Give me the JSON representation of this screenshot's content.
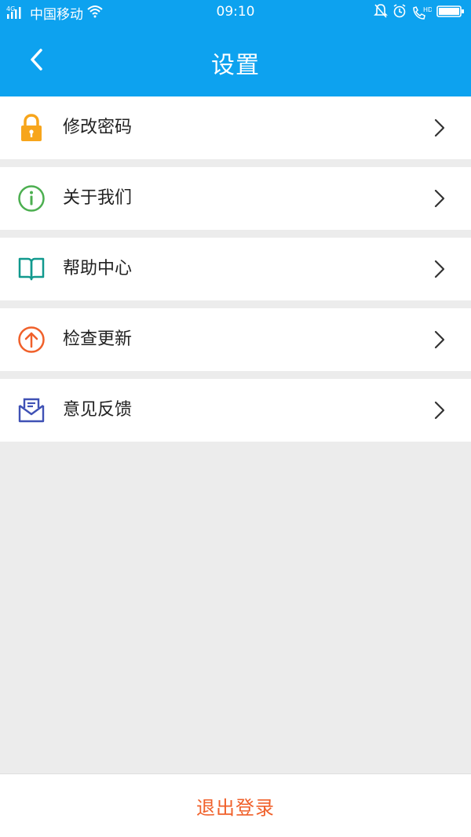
{
  "statusbar": {
    "network_badge": "4G",
    "carrier": "中国移动",
    "time": "09:10",
    "hd_badge": "HD",
    "icons": [
      "signal-icon",
      "wifi-icon",
      "mute-icon",
      "alarm-icon",
      "hd-call-icon",
      "battery-icon"
    ]
  },
  "navbar": {
    "title": "设置",
    "back_icon": "chevron-left-icon"
  },
  "menu": {
    "items": [
      {
        "label": "修改密码",
        "icon": "lock-icon",
        "icon_color": "#f7a51b"
      },
      {
        "label": "关于我们",
        "icon": "info-icon",
        "icon_color": "#4caf50"
      },
      {
        "label": "帮助中心",
        "icon": "book-icon",
        "icon_color": "#11998e"
      },
      {
        "label": "检查更新",
        "icon": "upload-icon",
        "icon_color": "#f0602a"
      },
      {
        "label": "意见反馈",
        "icon": "feedback-mail-icon",
        "icon_color": "#3f51b5"
      }
    ]
  },
  "footer": {
    "logout_label": "退出登录",
    "logout_color": "#f0602a"
  },
  "colors": {
    "accent": "#0da2ef",
    "background": "#ececec"
  }
}
